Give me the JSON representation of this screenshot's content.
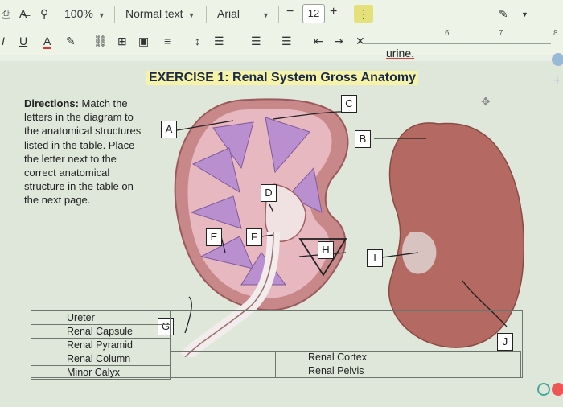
{
  "toolbar1": {
    "zoom": "100%",
    "style": "Normal text",
    "font": "Arial",
    "font_size": "12",
    "minus": "−",
    "plus": "+"
  },
  "toolbar2": {
    "underline": "U",
    "text_color": "A"
  },
  "ruler": {
    "six": "6",
    "seven": "7",
    "eight": "8"
  },
  "doc": {
    "prev_text_end": "urine.",
    "title": "EXERCISE 1: Renal System Gross Anatomy",
    "directions_bold": "Directions:",
    "directions_rest": " Match the letters in the diagram to the anatomical structures listed in the table. Place the letter next to the correct anatomical structure in the table on the next page."
  },
  "labels": {
    "A": "A",
    "B": "B",
    "C": "C",
    "D": "D",
    "E": "E",
    "F": "F",
    "G": "G",
    "H": "H",
    "I": "I",
    "J": "J"
  },
  "table": {
    "left": [
      "Ureter",
      "Renal Capsule",
      "Renal Pyramid",
      "Renal Column",
      "Minor Calyx"
    ],
    "right": [
      "Renal Cortex",
      "Renal Pelvis"
    ]
  },
  "colors": {
    "kidney_outer": "#c8888a",
    "kidney_cortex": "#e8b8c0",
    "pyramid": "#b98fd0",
    "specimen": "#b46a62",
    "highlight": "#f6f3a8"
  }
}
